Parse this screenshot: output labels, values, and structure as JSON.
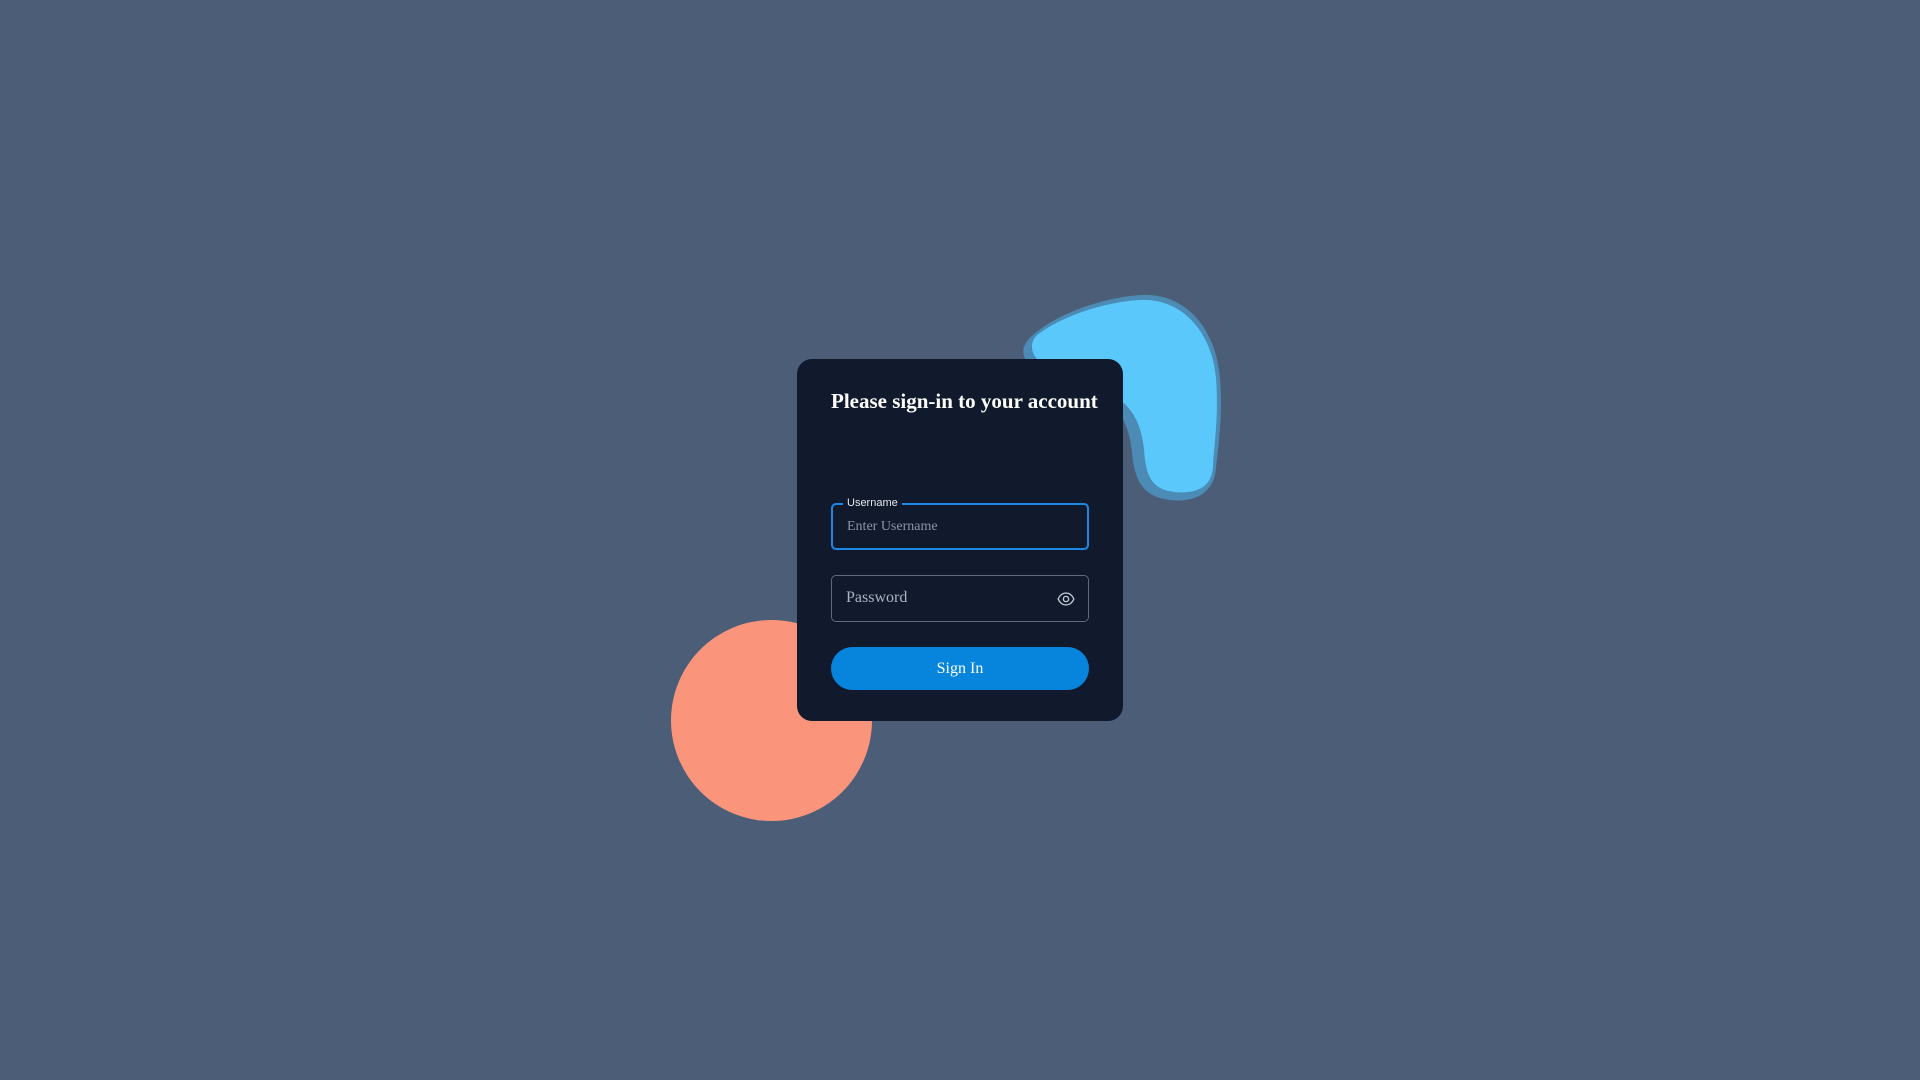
{
  "login": {
    "title": "Please sign-in to your account",
    "username": {
      "label": "Username",
      "placeholder": "Enter Username",
      "value": ""
    },
    "password": {
      "placeholder": "Password",
      "value": "",
      "toggle_icon": "eye-icon"
    },
    "submit_label": "Sign In"
  },
  "colors": {
    "background": "#4b5d77",
    "card": "#101a2c",
    "accent": "#0784dc",
    "focus_border": "#1e88e5",
    "blob": "#5ac8fa",
    "circle": "#fa957c"
  }
}
